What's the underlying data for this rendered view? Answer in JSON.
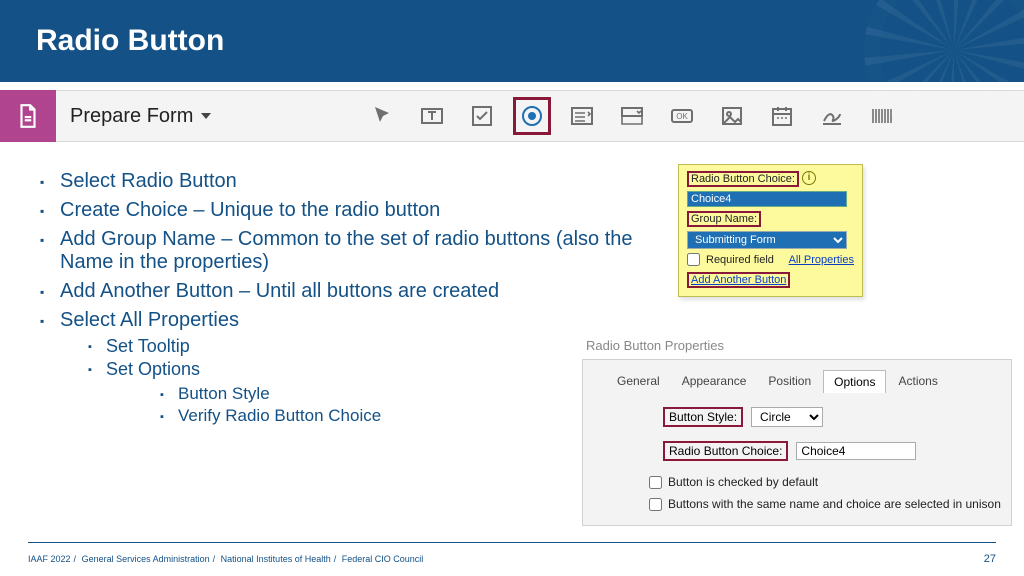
{
  "title": "Radio Button",
  "toolbar": {
    "prepare_label": "Prepare Form"
  },
  "bullets": {
    "i0": "Select Radio Button",
    "i1": "Create Choice – Unique to the radio button",
    "i2": "Add Group Name – Common to the set of radio buttons (also the Name in the properties)",
    "i3": "Add Another Button – Until all buttons are created",
    "i4": "Select All Properties",
    "i4a": "Set Tooltip",
    "i4b": "Set Options",
    "i4b1": "Button Style",
    "i4b2": "Verify Radio Button Choice"
  },
  "popup": {
    "choice_label": "Radio Button Choice:",
    "choice_value": "Choice4",
    "group_label": "Group Name:",
    "group_value": "Submitting Form",
    "required_label": "Required field",
    "all_props": "All Properties",
    "another": "Add Another Button"
  },
  "props": {
    "title": "Radio Button Properties",
    "tabs": {
      "general": "General",
      "appearance": "Appearance",
      "position": "Position",
      "options": "Options",
      "actions": "Actions"
    },
    "button_style_label": "Button Style:",
    "button_style_value": "Circle",
    "choice_label": "Radio Button Choice:",
    "choice_value": "Choice4",
    "chk1": "Button is checked by default",
    "chk2": "Buttons with the same name and choice are selected in unison"
  },
  "footer": {
    "text_parts": [
      "IAAF 2022",
      "General Services Administration",
      "National Institutes of Health",
      "Federal CIO Council"
    ],
    "page": "27"
  }
}
